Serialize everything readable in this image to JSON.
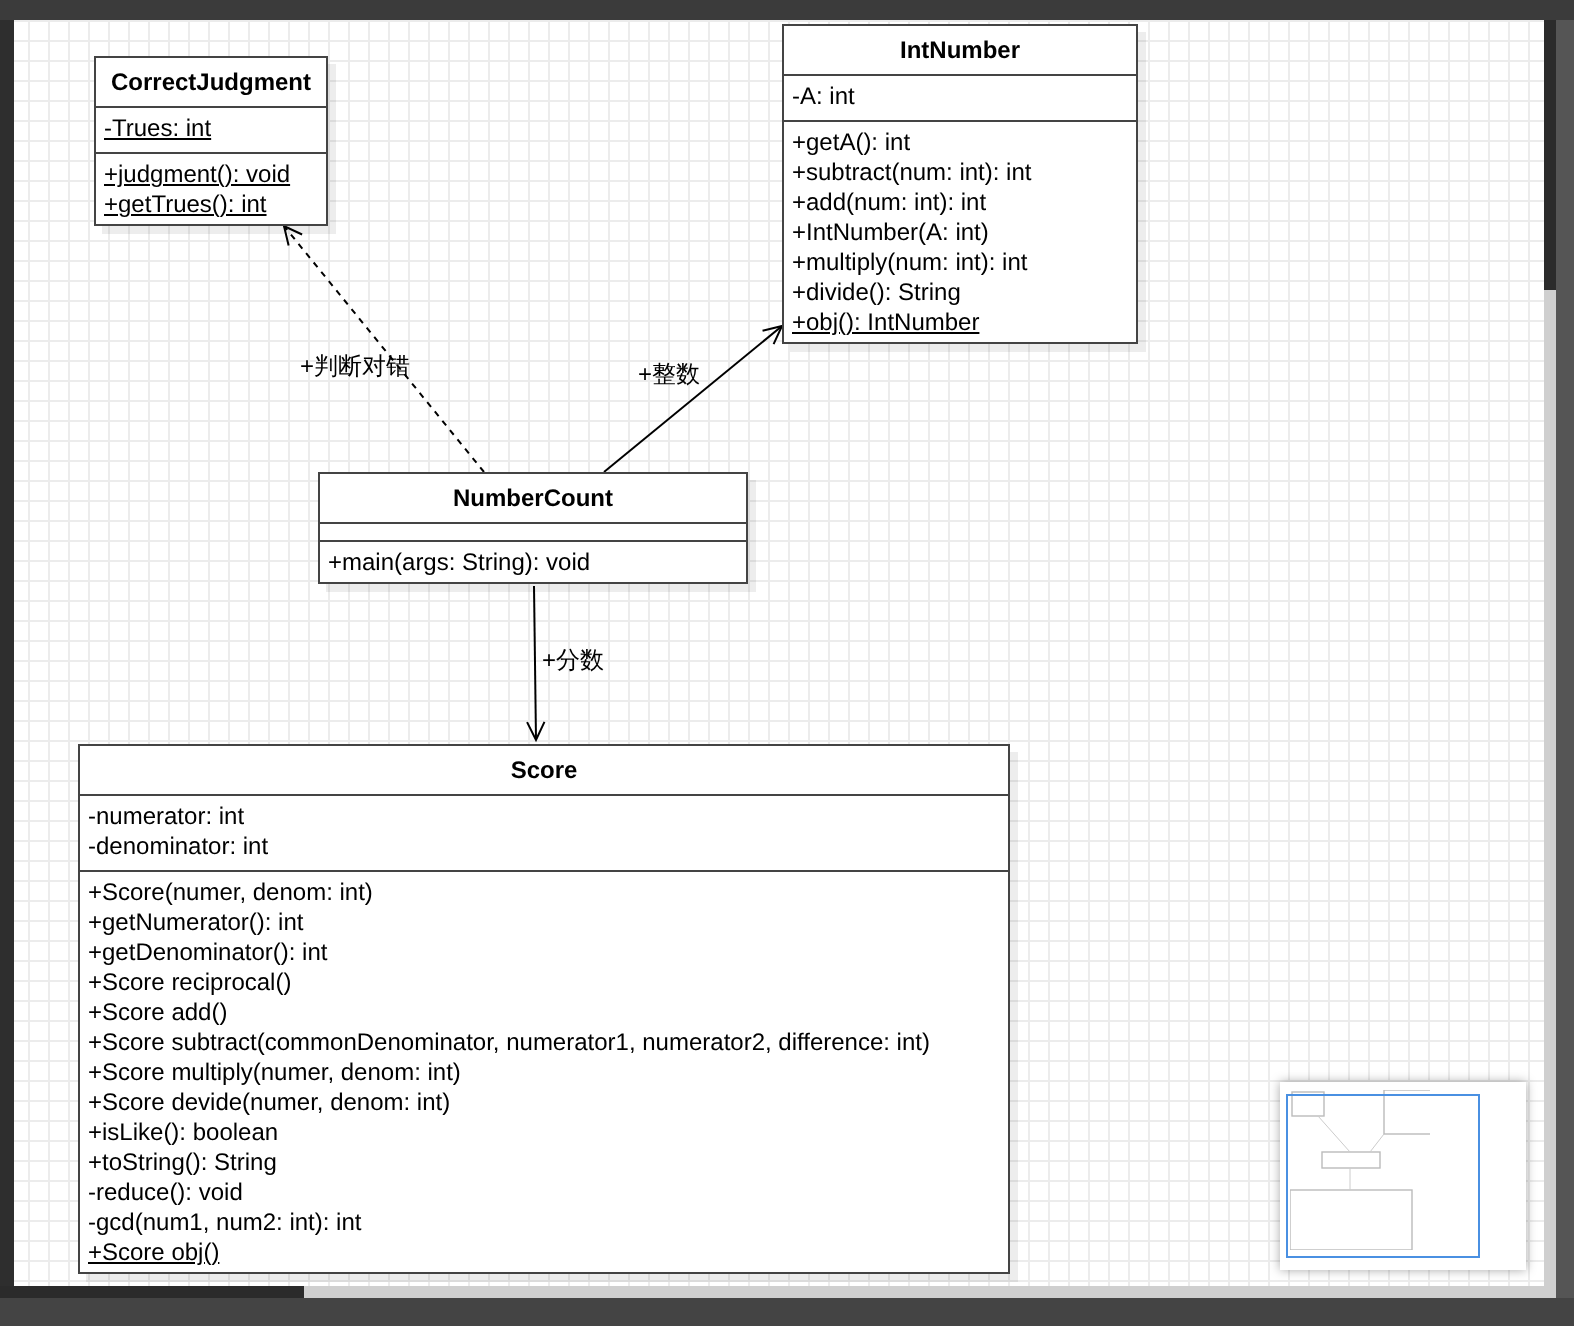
{
  "classes": [
    {
      "name": "CorrectJudgment",
      "attributes": [
        {
          "text": "-Trues: int",
          "static": true
        }
      ],
      "methods": [
        {
          "text": "+judgment(): void",
          "static": true
        },
        {
          "text": "+getTrues(): int",
          "static": true
        }
      ]
    },
    {
      "name": "IntNumber",
      "attributes": [
        {
          "text": "-A: int",
          "static": false
        }
      ],
      "methods": [
        {
          "text": "+getA(): int",
          "static": false
        },
        {
          "text": "+subtract(num: int): int",
          "static": false
        },
        {
          "text": "+add(num: int): int",
          "static": false
        },
        {
          "text": "+IntNumber(A: int)",
          "static": false
        },
        {
          "text": "+multiply(num: int): int",
          "static": false
        },
        {
          "text": "+divide(): String",
          "static": false
        },
        {
          "text": "+obj(): IntNumber",
          "static": true
        }
      ]
    },
    {
      "name": "NumberCount",
      "methods": [
        {
          "text": "+main(args: String): void",
          "static": false
        }
      ]
    },
    {
      "name": "Score",
      "attributes": [
        {
          "text": "-numerator: int",
          "static": false
        },
        {
          "text": "-denominator: int",
          "static": false
        }
      ],
      "methods": [
        {
          "text": "+Score(numer, denom: int)",
          "static": false
        },
        {
          "text": "+getNumerator(): int",
          "static": false
        },
        {
          "text": "+getDenominator(): int",
          "static": false
        },
        {
          "text": "+Score reciprocal()",
          "static": false
        },
        {
          "text": "+Score add()",
          "static": false
        },
        {
          "text": "+Score subtract(commonDenominator, numerator1, numerator2, difference: int)",
          "static": false
        },
        {
          "text": "+Score multiply(numer, denom: int)",
          "static": false
        },
        {
          "text": "+Score devide(numer, denom: int)",
          "static": false
        },
        {
          "text": "+isLike(): boolean",
          "static": false
        },
        {
          "text": "+toString(): String",
          "static": false
        },
        {
          "text": "-reduce(): void",
          "static": false
        },
        {
          "text": "-gcd(num1, num2: int): int",
          "static": false
        },
        {
          "text": "+Score obj()",
          "static": true
        }
      ]
    }
  ],
  "relations": [
    {
      "kind": "dependency",
      "label": "+判断对错"
    },
    {
      "kind": "association",
      "label": "+整数"
    },
    {
      "kind": "association",
      "label": "+分数"
    }
  ]
}
